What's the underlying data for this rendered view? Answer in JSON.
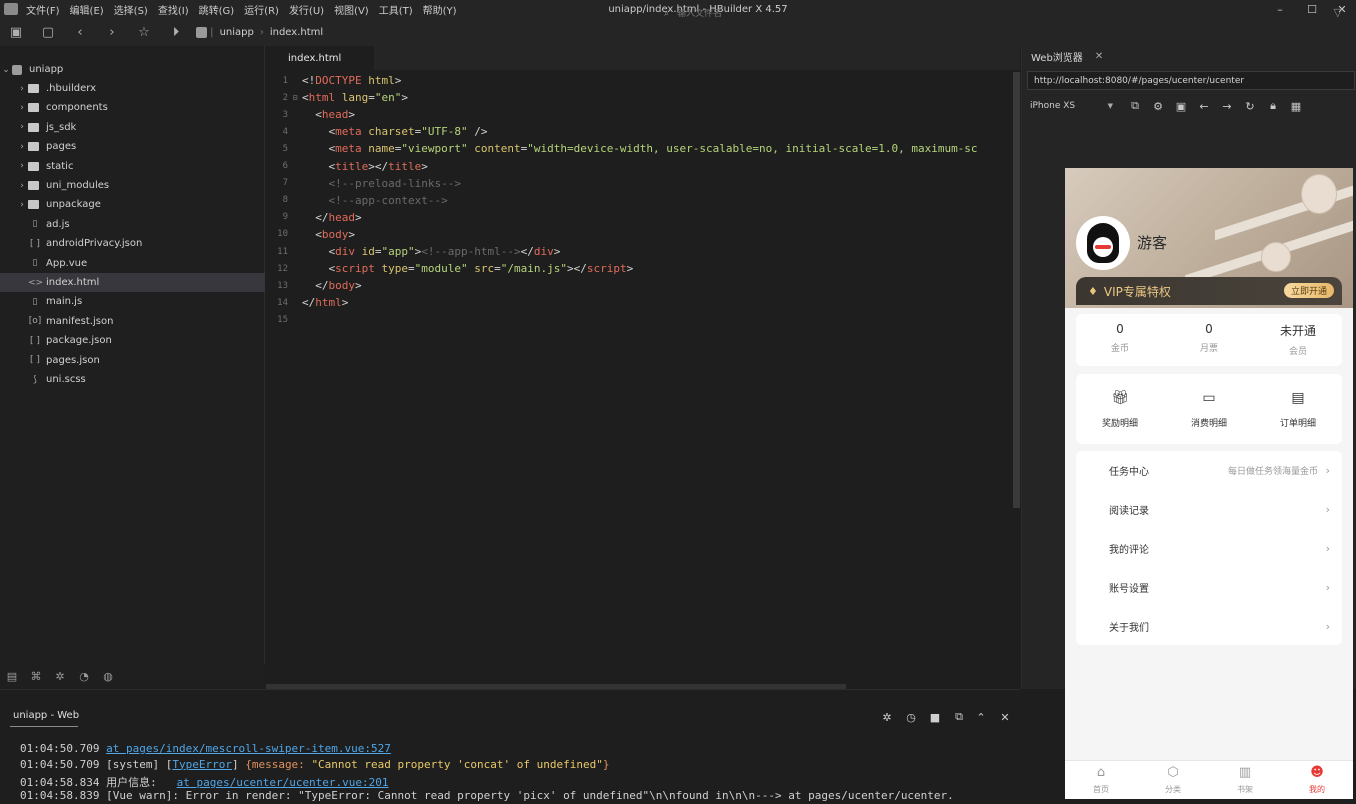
{
  "menubar": {
    "items": [
      "文件(F)",
      "编辑(E)",
      "选择(S)",
      "查找(I)",
      "跳转(G)",
      "运行(R)",
      "发行(U)",
      "视图(V)",
      "工具(T)",
      "帮助(Y)"
    ],
    "window_title": "uniapp/index.html - HBuilder X 4.57"
  },
  "toolbar": {
    "crumbs": [
      "uniapp",
      "index.html"
    ],
    "file_search_placeholder": "输入文件名"
  },
  "sidebar": {
    "project": "uniapp",
    "items": [
      {
        "label": ".hbuilderx",
        "type": "folder"
      },
      {
        "label": "components",
        "type": "folder"
      },
      {
        "label": "js_sdk",
        "type": "folder"
      },
      {
        "label": "pages",
        "type": "folder"
      },
      {
        "label": "static",
        "type": "folder"
      },
      {
        "label": "uni_modules",
        "type": "folder"
      },
      {
        "label": "unpackage",
        "type": "folder"
      },
      {
        "label": "ad.js",
        "type": "file",
        "glyph": "▯"
      },
      {
        "label": "androidPrivacy.json",
        "type": "file",
        "glyph": "[ ]"
      },
      {
        "label": "App.vue",
        "type": "file",
        "glyph": "▯"
      },
      {
        "label": "index.html",
        "type": "file",
        "glyph": "<>"
      },
      {
        "label": "main.js",
        "type": "file",
        "glyph": "▯"
      },
      {
        "label": "manifest.json",
        "type": "file",
        "glyph": "[o]"
      },
      {
        "label": "package.json",
        "type": "file",
        "glyph": "[ ]"
      },
      {
        "label": "pages.json",
        "type": "file",
        "glyph": "[ ]"
      },
      {
        "label": "uni.scss",
        "type": "file",
        "glyph": "⟆"
      }
    ],
    "active_index": 10
  },
  "editor": {
    "tab_label": "index.html",
    "lines": [
      {
        "n": "1",
        "fold": "",
        "html": "<span class='c-br'>&lt;!</span><span class='c-tag'>DOCTYPE</span> <span class='c-attr'>html</span><span class='c-br'>&gt;</span>"
      },
      {
        "n": "2",
        "fold": "⊟",
        "html": "<span class='c-br'>&lt;</span><span class='c-tag'>html</span> <span class='c-attr'>lang</span>=<span class='c-str'>\"en\"</span><span class='c-br'>&gt;</span>"
      },
      {
        "n": "3",
        "fold": "",
        "html": "  <span class='c-br'>&lt;</span><span class='c-tag'>head</span><span class='c-br'>&gt;</span>"
      },
      {
        "n": "4",
        "fold": "",
        "html": "    <span class='c-br'>&lt;</span><span class='c-tag'>meta</span> <span class='c-attr'>charset</span>=<span class='c-str'>\"UTF-8\"</span> /<span class='c-br'>&gt;</span>"
      },
      {
        "n": "5",
        "fold": "",
        "html": "    <span class='c-br'>&lt;</span><span class='c-tag'>meta</span> <span class='c-attr'>name</span>=<span class='c-str'>\"viewport\"</span> <span class='c-attr'>content</span>=<span class='c-str'>\"width=device-width, user-scalable=no, initial-scale=1.0, maximum-sc</span>"
      },
      {
        "n": "6",
        "fold": "",
        "html": "    <span class='c-br'>&lt;</span><span class='c-tag'>title</span><span class='c-br'>&gt;&lt;/</span><span class='c-tag'>title</span><span class='c-br'>&gt;</span>"
      },
      {
        "n": "7",
        "fold": "",
        "html": "    <span class='c-com'>&lt;!--preload-links--&gt;</span>"
      },
      {
        "n": "8",
        "fold": "",
        "html": "    <span class='c-com'>&lt;!--app-context--&gt;</span>"
      },
      {
        "n": "9",
        "fold": "",
        "html": "  <span class='c-br'>&lt;/</span><span class='c-tag'>head</span><span class='c-br'>&gt;</span>"
      },
      {
        "n": "10",
        "fold": "",
        "html": "  <span class='c-br'>&lt;</span><span class='c-tag'>body</span><span class='c-br'>&gt;</span>"
      },
      {
        "n": "11",
        "fold": "",
        "html": "    <span class='c-br'>&lt;</span><span class='c-tag'>div</span> <span class='c-attr'>id</span>=<span class='c-str'>\"app\"</span><span class='c-br'>&gt;</span><span class='c-com'>&lt;!--app-html--&gt;</span><span class='c-br'>&lt;/</span><span class='c-tag'>div</span><span class='c-br'>&gt;</span>"
      },
      {
        "n": "12",
        "fold": "",
        "html": "    <span class='c-br'>&lt;</span><span class='c-tag'>script</span> <span class='c-attr'>type</span>=<span class='c-str'>\"module\"</span> <span class='c-attr'>src</span>=<span class='c-str'>\"/main.js\"</span><span class='c-br'>&gt;&lt;/</span><span class='c-tag'>script</span><span class='c-br'>&gt;</span>"
      },
      {
        "n": "13",
        "fold": "",
        "html": "  <span class='c-br'>&lt;/</span><span class='c-tag'>body</span><span class='c-br'>&gt;</span>"
      },
      {
        "n": "14",
        "fold": "",
        "html": "<span class='c-br'>&lt;/</span><span class='c-tag'>html</span><span class='c-br'>&gt;</span>"
      },
      {
        "n": "15",
        "fold": "",
        "html": ""
      }
    ]
  },
  "browser": {
    "tab_label": "Web浏览器",
    "url": "http://localhost:8080/#/pages/ucenter/ucenter",
    "device": "iPhone XS"
  },
  "phone": {
    "username": "游客",
    "vip_text": "VIP专属特权",
    "vip_button": "立即开通",
    "stats": [
      {
        "value": "0",
        "label": "金币"
      },
      {
        "value": "0",
        "label": "月票"
      },
      {
        "value": "未开通",
        "label": "会员"
      }
    ],
    "quick": [
      {
        "icon": "gift-icon",
        "glyph": "🎁︎",
        "label": "奖励明细"
      },
      {
        "icon": "ticket-icon",
        "glyph": "▭",
        "label": "消费明细"
      },
      {
        "icon": "order-icon",
        "glyph": "▤",
        "label": "订单明细"
      }
    ],
    "menu": [
      {
        "label": "任务中心",
        "hint": "每日做任务领海量金币"
      },
      {
        "label": "阅读记录",
        "hint": ""
      },
      {
        "label": "我的评论",
        "hint": ""
      },
      {
        "label": "账号设置",
        "hint": ""
      },
      {
        "label": "关于我们",
        "hint": ""
      }
    ],
    "tabs": [
      {
        "icon": "home-icon",
        "glyph": "⌂",
        "label": "首页"
      },
      {
        "icon": "category-icon",
        "glyph": "⬡",
        "label": "分类"
      },
      {
        "icon": "bookshelf-icon",
        "glyph": "▥",
        "label": "书架"
      },
      {
        "icon": "mine-icon",
        "glyph": "☻",
        "label": "我的"
      }
    ],
    "active_tab": 3
  },
  "console": {
    "title": "uniapp - Web",
    "lines": [
      {
        "time": "01:04:50.709",
        "parts": [
          {
            "t": " ",
            "c": ""
          },
          {
            "t": "at pages/index/mescroll-swiper-item.vue:527",
            "c": "log-link"
          }
        ]
      },
      {
        "time": "01:04:50.709",
        "parts": [
          {
            "t": " [system] [",
            "c": ""
          },
          {
            "t": "TypeError",
            "c": "log-link"
          },
          {
            "t": "] ",
            "c": ""
          },
          {
            "t": "{message: ",
            "c": "log-err"
          },
          {
            "t": "\"Cannot read property 'concat' of undefined\"",
            "c": "log-msg"
          },
          {
            "t": "}",
            "c": "log-err"
          }
        ]
      },
      {
        "time": "01:04:58.834",
        "parts": [
          {
            "t": " 用户信息:   ",
            "c": ""
          },
          {
            "t": "at pages/ucenter/ucenter.vue:201",
            "c": "log-link"
          }
        ]
      },
      {
        "time": "01:04:58.839",
        "parts": [
          {
            "t": " [Vue warn]: Error in render: \"TypeError: Cannot read property 'picx' of undefined\"\\n\\nfound in\\n\\n---> at pages/ucenter/ucenter.",
            "c": ""
          }
        ]
      }
    ]
  }
}
